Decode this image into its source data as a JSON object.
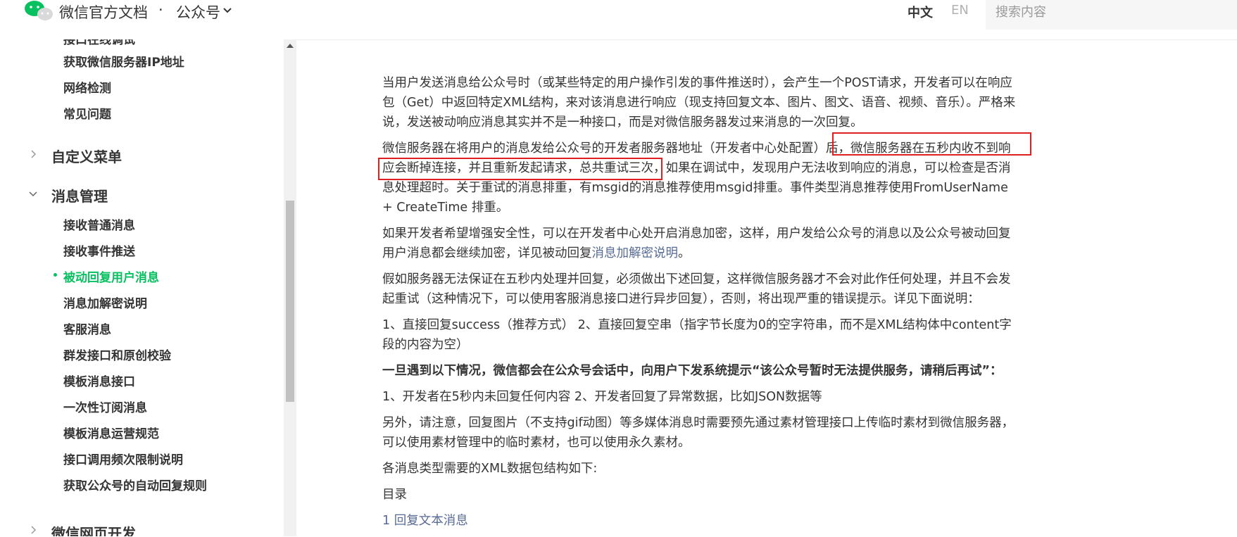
{
  "header": {
    "brand": "微信官方文档",
    "separator": "·",
    "section": "公众号",
    "lang_zh": "中文",
    "lang_en": "EN",
    "search_placeholder": "搜索内容"
  },
  "sidebar": {
    "items_top": [
      "接口在线调试",
      "获取微信服务器IP地址",
      "网络检测",
      "常见问题"
    ],
    "group_custom_menu": "自定义菜单",
    "group_message": "消息管理",
    "message_items": [
      "接收普通消息",
      "接收事件推送",
      "被动回复用户消息",
      "消息加解密说明",
      "客服消息",
      "群发接口和原创校验",
      "模板消息接口",
      "一次性订阅消息",
      "模板消息运营规范",
      "接口调用频次限制说明",
      "获取公众号的自动回复规则"
    ],
    "active_item": "被动回复用户消息",
    "next_group": "微信网页开发"
  },
  "content": {
    "p1": "当用户发送消息给公众号时（或某些特定的用户操作引发的事件推送时），会产生一个POST请求，开发者可以在响应包（Get）中返回特定XML结构，来对该消息进行响应（现支持回复文本、图片、图文、语音、视频、音乐）。严格来说，发送被动响应消息其实并不是一种接口，而是对微信服务器发过来消息的一次回复。",
    "p2": "微信服务器在将用户的消息发给公众号的开发者服务器地址（开发者中心处配置）后，微信服务器在五秒内收不到响应会断掉连接，并且重新发起请求，总共重试三次，如果在调试中，发现用户无法收到响应的消息，可以检查是否消息处理超时。关于重试的消息排重，有msgid的消息推荐使用msgid排重。事件类型消息推荐使用FromUserName + CreateTime 排重。",
    "p3_before": "如果开发者希望增强安全性，可以在开发者中心处开启消息加密，这样，用户发给公众号的消息以及公众号被动回复用户消息都会继续加密，详见被动回复",
    "p3_link": "消息加解密说明",
    "p3_after": "。",
    "p4": "假如服务器无法保证在五秒内处理并回复，必须做出下述回复，这样微信服务器才不会对此作任何处理，并且不会发起重试（这种情况下，可以使用客服消息接口进行异步回复），否则，将出现严重的错误提示。详见下面说明：",
    "p5": "1、直接回复success（推荐方式） 2、直接回复空串（指字节长度为0的空字符串，而不是XML结构体中content字段的内容为空）",
    "p6": "一旦遇到以下情况，微信都会在公众号会话中，向用户下发系统提示“该公众号暂时无法提供服务，请稍后再试”：",
    "p7": "1、开发者在5秒内未回复任何内容 2、开发者回复了异常数据，比如JSON数据等",
    "p8": "另外，请注意，回复图片（不支持gif动图）等多媒体消息时需要预先通过素材管理接口上传临时素材到微信服务器，可以使用素材管理中的临时素材，也可以使用永久素材。",
    "p9": "各消息类型需要的XML数据包结构如下:",
    "toc_label": "目录",
    "toc_1": "1 回复文本消息"
  },
  "colors": {
    "accent_green": "#07c160",
    "link": "#576b95",
    "highlight_red": "#e02020"
  }
}
